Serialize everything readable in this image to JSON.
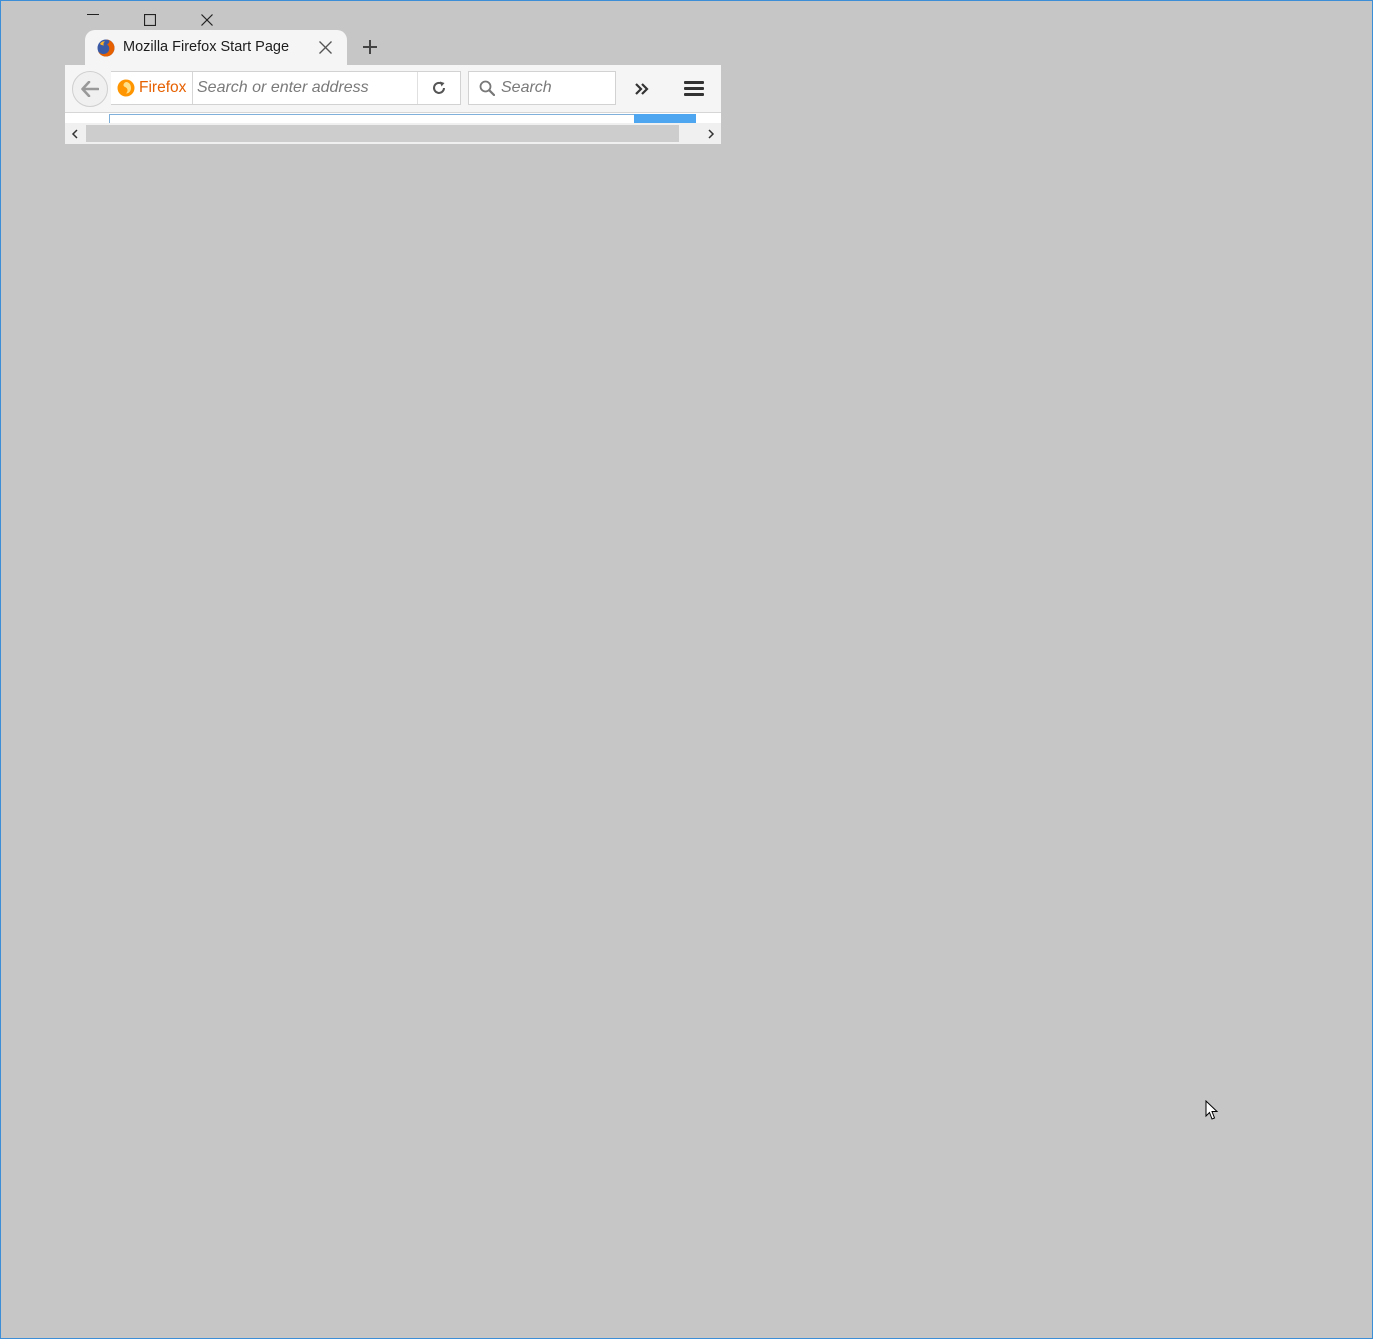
{
  "window": {
    "minimize_icon": "minimize-icon",
    "maximize_icon": "maximize-icon",
    "close_icon": "close-icon"
  },
  "tab": {
    "title": "Mozilla Firefox Start Page",
    "favicon": "firefox-logo-icon",
    "close_icon": "close-icon"
  },
  "new_tab_icon": "plus-icon",
  "toolbar": {
    "back_icon": "arrow-left-icon",
    "identity_label": "Firefox",
    "url_placeholder": "Search or enter address",
    "reload_icon": "reload-icon",
    "search_placeholder": "Search",
    "overflow_icon": "double-chevron-right-icon",
    "menu_icon": "hamburger-menu-icon"
  },
  "scrollbar": {
    "left_icon": "chevron-left-icon",
    "right_icon": "chevron-right-icon"
  },
  "colors": {
    "desktop_background": "#c6c6c6",
    "window_border": "#3c8fd6",
    "firefox_orange": "#e66000",
    "content_search_button": "#4da6ef"
  }
}
